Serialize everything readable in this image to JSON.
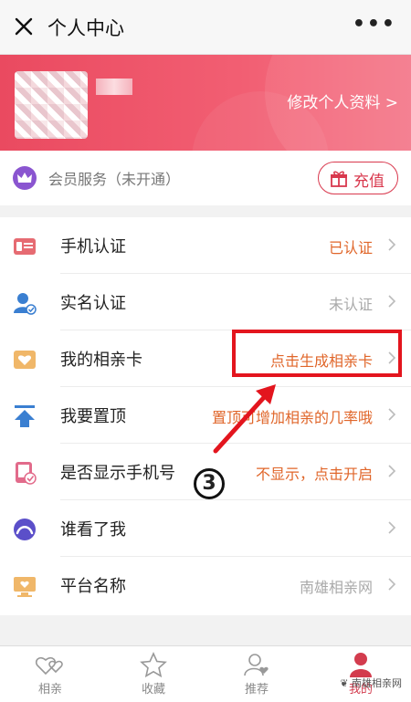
{
  "titlebar": {
    "title": "个人中心",
    "more": "•••"
  },
  "profile": {
    "edit_label": "修改个人资料 >"
  },
  "member": {
    "label": "会员服务（未开通）",
    "recharge_label": "充值"
  },
  "rows": [
    {
      "name": "手机认证",
      "value": "已认证",
      "value_style": "orange",
      "icon": "phone-id-icon"
    },
    {
      "name": "实名认证",
      "value": "未认证",
      "value_style": "gray",
      "icon": "user-verify-icon"
    },
    {
      "name": "我的相亲卡",
      "value": "点击生成相亲卡",
      "value_style": "orange",
      "icon": "heart-card-icon"
    },
    {
      "name": "我要置顶",
      "value": "置顶可增加相亲的几率哦",
      "value_style": "orange",
      "icon": "pin-top-icon"
    },
    {
      "name": "是否显示手机号",
      "value": "不显示，点击开启",
      "value_style": "orange",
      "icon": "phone-display-icon"
    },
    {
      "name": "谁看了我",
      "value": "",
      "value_style": "gray",
      "icon": "viewers-icon"
    },
    {
      "name": "平台名称",
      "value": "南雄相亲网",
      "value_style": "gray",
      "icon": "platform-icon"
    }
  ],
  "annotation": {
    "number": "3"
  },
  "tabs": [
    {
      "label": "相亲",
      "icon": "hearts-icon",
      "active": false
    },
    {
      "label": "收藏",
      "icon": "star-icon",
      "active": false
    },
    {
      "label": "推荐",
      "icon": "person-heart-icon",
      "active": false
    },
    {
      "label": "我的",
      "icon": "me-icon",
      "active": true
    }
  ],
  "watermark": "南雄相亲网",
  "colors": {
    "brand": "#ea4a60",
    "accent": "#e0662a",
    "annotation": "#e3151e"
  }
}
